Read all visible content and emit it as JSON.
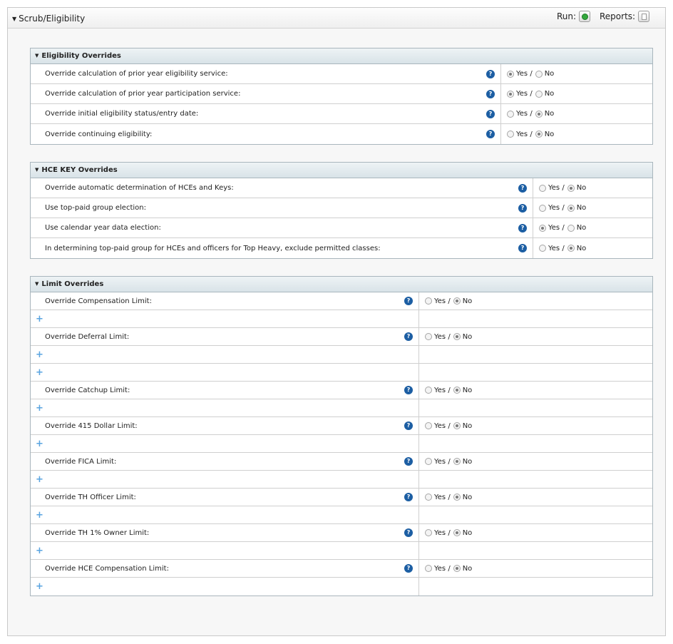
{
  "panel": {
    "title": "Scrub/Eligibility",
    "run_label": "Run:",
    "reports_label": "Reports:"
  },
  "radio_labels": {
    "yes": "Yes /",
    "no": "No"
  },
  "eligibility": {
    "title": "Eligibility Overrides",
    "rows": [
      {
        "label": "Override calculation of prior year eligibility service:",
        "selected": "yes"
      },
      {
        "label": "Override calculation of prior year participation service:",
        "selected": "yes"
      },
      {
        "label": "Override initial eligibility status/entry date:",
        "selected": "no"
      },
      {
        "label": "Override continuing eligibility:",
        "selected": "no"
      }
    ]
  },
  "hce": {
    "title": "HCE KEY Overrides",
    "rows": [
      {
        "label": "Override automatic determination of HCEs and Keys:",
        "selected": "no"
      },
      {
        "label": "Use top-paid group election:",
        "selected": "no"
      },
      {
        "label": "Use calendar year data election:",
        "selected": "yes"
      },
      {
        "label": "In determining top-paid group for HCEs and officers for Top Heavy, exclude permitted classes:",
        "selected": "no"
      }
    ]
  },
  "limits": {
    "title": "Limit Overrides",
    "rows": [
      {
        "type": "option",
        "label": "Override Compensation Limit:",
        "selected": "no"
      },
      {
        "type": "add",
        "symbol": "+"
      },
      {
        "type": "option",
        "label": "Override Deferral Limit:",
        "selected": "no"
      },
      {
        "type": "add",
        "symbol": "+"
      },
      {
        "type": "add",
        "symbol": "+"
      },
      {
        "type": "option",
        "label": "Override Catchup Limit:",
        "selected": "no"
      },
      {
        "type": "add",
        "symbol": "+"
      },
      {
        "type": "option",
        "label": "Override 415 Dollar Limit:",
        "selected": "no"
      },
      {
        "type": "add",
        "symbol": "+"
      },
      {
        "type": "option",
        "label": "Override FICA Limit:",
        "selected": "no"
      },
      {
        "type": "add",
        "symbol": "+"
      },
      {
        "type": "option",
        "label": "Override TH Officer Limit:",
        "selected": "no"
      },
      {
        "type": "add",
        "symbol": "+"
      },
      {
        "type": "option",
        "label": "Override TH 1% Owner Limit:",
        "selected": "no"
      },
      {
        "type": "add",
        "symbol": "+"
      },
      {
        "type": "option",
        "label": "Override HCE Compensation Limit:",
        "selected": "no"
      },
      {
        "type": "add",
        "symbol": "+"
      }
    ]
  },
  "icons": {
    "collapse": "caret-down-icon",
    "help": "question-icon",
    "run": "run-icon",
    "reports": "reports-icon",
    "add": "plus-icon"
  }
}
